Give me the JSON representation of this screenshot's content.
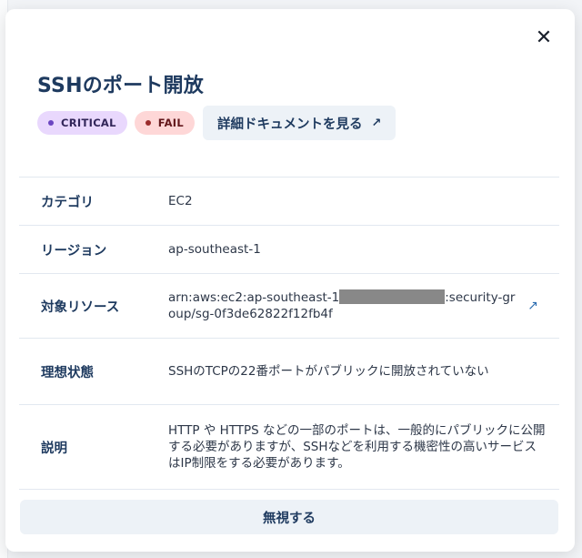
{
  "modal": {
    "title": "SSHのポート開放",
    "close_icon": "close-icon",
    "badges": {
      "severity": "CRITICAL",
      "status": "FAIL"
    },
    "doc_button": "詳細ドキュメントを見る",
    "external_icon": "external-link-icon",
    "rows": {
      "category": {
        "label": "カテゴリ",
        "value": "EC2"
      },
      "region": {
        "label": "リージョン",
        "value": "ap-southeast-1"
      },
      "resource": {
        "label": "対象リソース",
        "value_prefix": "arn:aws:ec2:ap-southeast-1",
        "value_suffix": ":security-group/sg-0f3de62822f12fb4f"
      },
      "ideal": {
        "label": "理想状態",
        "value": "SSHのTCPの22番ポートがパブリックに開放されていない"
      },
      "description": {
        "label": "説明",
        "value": "HTTP や HTTPS などの一部のポートは、一般的にパブリックに公開する必要がありますが、SSHなどを利用する機密性の高いサービスはIP制限をする必要があります。"
      }
    },
    "ignore_button": "無視する"
  },
  "colors": {
    "title": "#1e3a5f",
    "critical_bg": "#e9d8fd",
    "fail_bg": "#fed7d7",
    "link": "#2b6cb0",
    "button_bg": "#edf2f7"
  }
}
